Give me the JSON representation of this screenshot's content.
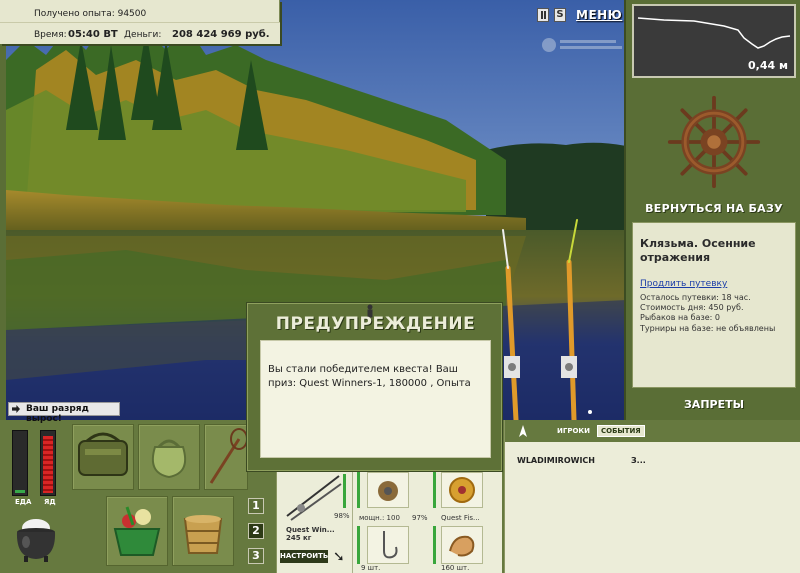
{
  "hud": {
    "experience_text": "Получено опыта: 94500",
    "time_label": "Время:",
    "time_value": "05:40 ВТ",
    "money_label": "Деньги:",
    "money_value": "208 424 969 руб.",
    "menu_label": "МЕНЮ",
    "sound_label": "S",
    "rank_message": "Ваш разряд вырос!"
  },
  "depth": {
    "value": "0,44 м"
  },
  "base": {
    "return_label": "ВЕРНУТЬСЯ НА БАЗУ",
    "location_title": "Клязьма. Осенние отражения",
    "extend_link": "Продлить путевку",
    "time_left": "Осталось путевки: 18 час.",
    "day_cost": "Стоимость дня: 450 руб.",
    "anglers": "Рыбаков на базе: 0",
    "tournaments": "Турниры на базе: не объявлены",
    "bans_label": "ЗАПРЕТЫ"
  },
  "status": {
    "food_label": "ЕДА",
    "poison_label": "ЯД",
    "food_level": 0.05,
    "poison_level": 0.95
  },
  "inventory": {
    "pages": [
      "1",
      "2",
      "3"
    ],
    "active_page": 2
  },
  "tackle": {
    "rod_name": "Quest Win...",
    "rod_weight": "245 кг",
    "rod_condition": "98%",
    "setup_label": "НАСТРОИТЬ",
    "reel_text": "мощн.: 100",
    "reel_condition": "97%",
    "line_name": "Quest Fis...",
    "hook_count": "9 шт.",
    "bait_count": "160 шт."
  },
  "social": {
    "tab_players": "ИГРОКИ",
    "tab_events": "СОБЫТИЯ",
    "event_player": "WLADIMIROWICH",
    "event_more": "З..."
  },
  "dialog": {
    "title": "ПРЕДУПРЕЖДЕНИЕ",
    "message": "Вы стали победителем квеста! Ваш приз: Quest Winners-1, 180000 , Опыта"
  },
  "colors": {
    "panel_green": "#5a6e36",
    "panel_light": "#e6e7cf",
    "bar_green": "#39a63c",
    "poison_red": "#d92525"
  }
}
